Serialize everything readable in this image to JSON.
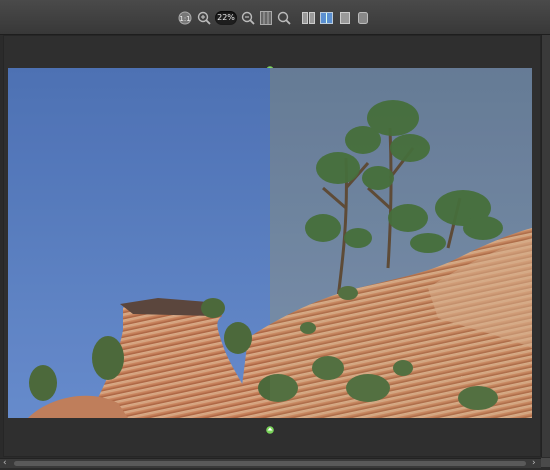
{
  "toolbar": {
    "zoom_level": "22%",
    "buttons": [
      {
        "name": "fit-to-window-icon"
      },
      {
        "name": "zoom-in-icon"
      },
      {
        "name": "zoom-out-icon"
      },
      {
        "name": "actual-size-icon"
      },
      {
        "name": "zoom-tool-icon"
      },
      {
        "name": "view-side-by-side-icon"
      },
      {
        "name": "view-split-icon"
      },
      {
        "name": "view-single-icon"
      },
      {
        "name": "view-before-icon"
      }
    ]
  },
  "viewer": {
    "split_position": 0.5,
    "icons": [
      "split-marker-top-icon",
      "split-marker-bottom-icon"
    ]
  },
  "colors": {
    "background": "#2b2b2b",
    "sky_before": "#5b80bf",
    "sky_after": "#7187a3",
    "marker": "#7ad35a"
  }
}
